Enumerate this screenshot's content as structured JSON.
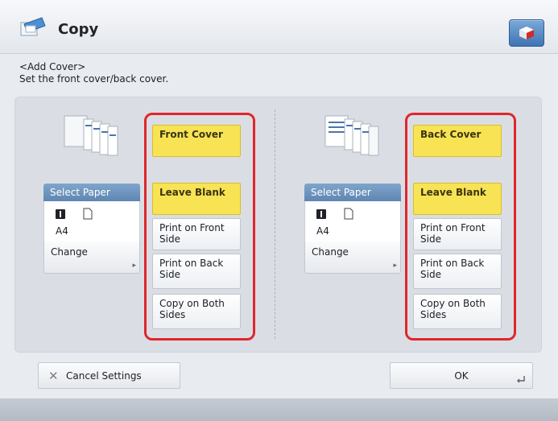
{
  "header": {
    "title": "Copy"
  },
  "instruction": {
    "line1": "<Add Cover>",
    "line2": "Set the front cover/back cover."
  },
  "front": {
    "select_paper_label": "Select Paper",
    "paper_size": "A4",
    "change_label": "Change",
    "cover_label": "Front Cover",
    "options": [
      "Leave Blank",
      "Print on Front Side",
      "Print on Back Side",
      "Copy on Both Sides"
    ],
    "selected_option": "Leave Blank"
  },
  "back": {
    "select_paper_label": "Select Paper",
    "paper_size": "A4",
    "change_label": "Change",
    "cover_label": "Back Cover",
    "options": [
      "Leave Blank",
      "Print on Front Side",
      "Print on Back Side",
      "Copy on Both Sides"
    ],
    "selected_option": "Leave Blank"
  },
  "footer": {
    "cancel_label": "Cancel Settings",
    "ok_label": "OK"
  },
  "colors": {
    "selected_yellow": "#f8e354",
    "highlight_red": "#e0262c",
    "header_blue": "#5f86b1"
  },
  "icons": [
    "copy-app-icon",
    "counter-check-icon",
    "paper-stack-icon",
    "paper-tray-icon",
    "sheet-icon",
    "close-icon",
    "enter-icon"
  ]
}
